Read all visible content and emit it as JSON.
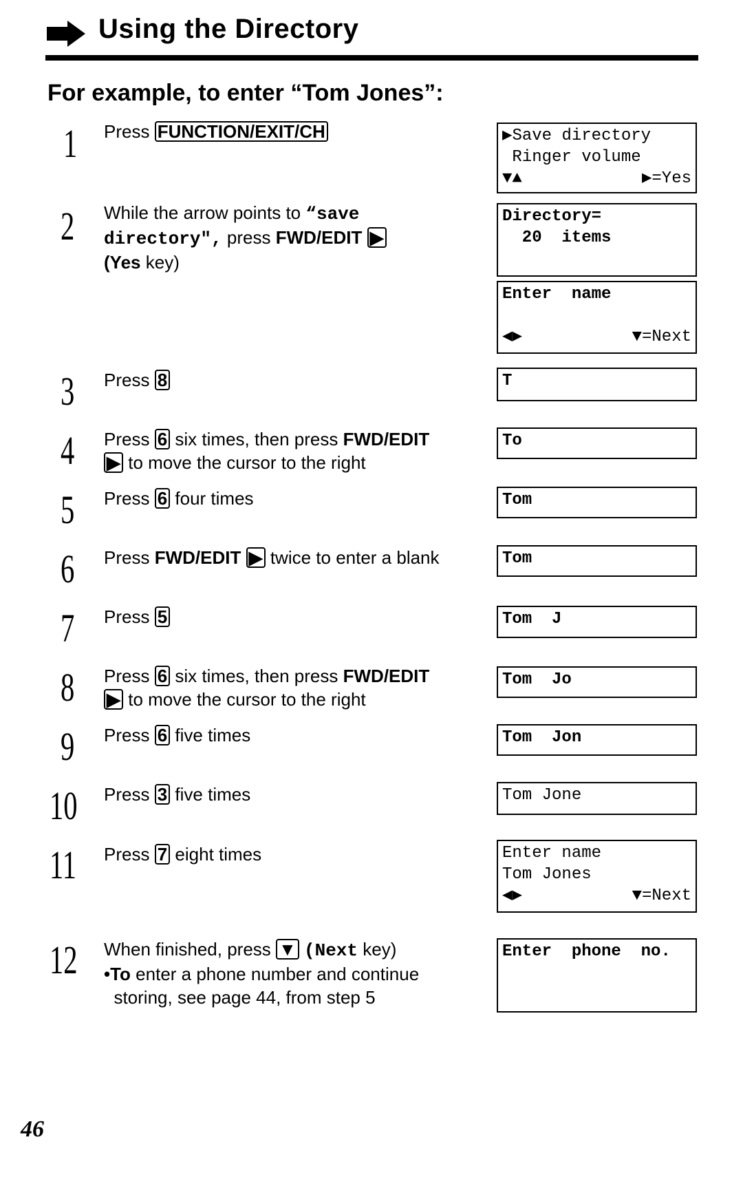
{
  "header": {
    "title": "Using the Directory",
    "icon": "right-arrow-icon"
  },
  "heading": "For example, to enter “Tom Jones”:",
  "steps": [
    {
      "n": "1",
      "pre": "Press",
      "key": "FUNCTION/EXIT/CH"
    },
    {
      "n": "2",
      "a": "While the arrow points to",
      "b": "“save directory\",",
      "c": "press",
      "d": "FWD/EDIT",
      "e": "(Yes",
      "f": "key)"
    },
    {
      "n": "3",
      "pre": "Press",
      "key": "8"
    },
    {
      "n": "4",
      "pre": "Press",
      "key": "6",
      "post": "six times, then press",
      "bold": "FWD/EDIT",
      "post2": "to move the cursor to the right"
    },
    {
      "n": "5",
      "pre": "Press",
      "key": "6",
      "post": "four times"
    },
    {
      "n": "6",
      "pre": "Press",
      "bold": "FWD/EDIT",
      "post": "twice to enter a blank"
    },
    {
      "n": "7",
      "pre": "Press",
      "key": "5"
    },
    {
      "n": "8",
      "pre": "Press",
      "key": "6",
      "post": "six times, then press",
      "bold": "FWD/EDIT",
      "post2": "to move the cursor to the right"
    },
    {
      "n": "9",
      "pre": "Press",
      "key": "6",
      "post": "five times"
    },
    {
      "n": "10",
      "pre": "Press",
      "key": "3",
      "post": "five times"
    },
    {
      "n": "11",
      "pre": "Press",
      "key": "7",
      "post": "eight times"
    },
    {
      "n": "12",
      "pre": "When finished, press",
      "key": "▼",
      "b": "(Next",
      "c": "key)",
      "d": "•To",
      "e": "enter a phone number and continue",
      "f": "storing, see page 44, from step 5"
    }
  ],
  "displays": {
    "d1": {
      "l1": "▶Save directory",
      "l2": " Ringer volume",
      "l3a": "▼▲",
      "l3b": "▶=Yes"
    },
    "d2": {
      "l1": "Directory=",
      "l2": "  20  items"
    },
    "d3": {
      "l1": "Enter  name",
      "l3a": "◀▶",
      "l3b": "▼=Next"
    },
    "d4": "T",
    "d5": "To",
    "d6": "Tom",
    "d7": "Tom",
    "d8": "Tom  J",
    "d9": "Tom  Jo",
    "d10": "Tom  Jon",
    "d11": "Tom Jone",
    "d12": {
      "l1": "Enter name",
      "l2": "Tom Jones",
      "l3a": "◀▶",
      "l3b": "▼=Next"
    },
    "d13": "Enter  phone  no."
  },
  "page_number": "46"
}
